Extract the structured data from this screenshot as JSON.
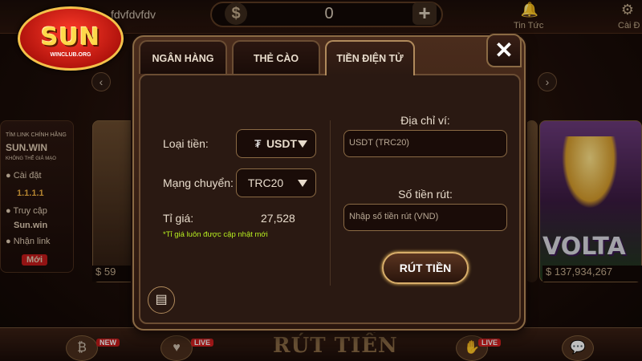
{
  "topbar": {
    "username": "fdvfdvfdv",
    "balance": "0",
    "dollar_icon": "dollar-icon",
    "plus_icon": "plus-icon",
    "news_label": "Tin Tức",
    "settings_label": "Cài Đ"
  },
  "logo": {
    "text": "SUN",
    "sub": "WINCLUB.ORG"
  },
  "background": {
    "left_card_lines": [
      "TÌM LINK CHÍNH HÃNG",
      "SUN.WIN",
      "KHÔNG THỂ GIẢ MẠO",
      "● Cài đặt",
      "1.1.1.1",
      "● Truy cập",
      "Sun.win",
      "● Nhận link",
      "Mới"
    ],
    "left_jackpot": "$ 59",
    "right_game_title": "VOLTA",
    "right_jackpot": "$ 137,934,267",
    "bottom_main_label": "RÚT TIỀN",
    "badge_new": "NEW",
    "badge_live_1": "LIVE",
    "badge_live_2": "LIVE"
  },
  "dialog": {
    "tabs": [
      {
        "label": "NGÂN HÀNG",
        "active": false
      },
      {
        "label": "THẺ CÀO",
        "active": false
      },
      {
        "label": "TIỀN ĐIỆN TỬ",
        "active": true
      }
    ],
    "close_label": "✕",
    "form": {
      "currency_label": "Loại tiền:",
      "currency_value": "USDT",
      "network_label": "Mạng chuyển:",
      "network_value": "TRC20",
      "rate_label": "Tỉ giá:",
      "rate_value": "27,528",
      "rate_note": "*Tỉ giá luôn được cập nhật mới",
      "wallet_label": "Địa chỉ ví:",
      "wallet_value": "USDT (TRC20)",
      "amount_label": "Số tiền rút:",
      "amount_placeholder": "Nhập số tiền rút (VND)",
      "submit_label": "RÚT TIỀN"
    }
  },
  "colors": {
    "accent_gold": "#d8ae6a",
    "dialog_bg": "#2a1912",
    "note_green": "#b8f020"
  }
}
